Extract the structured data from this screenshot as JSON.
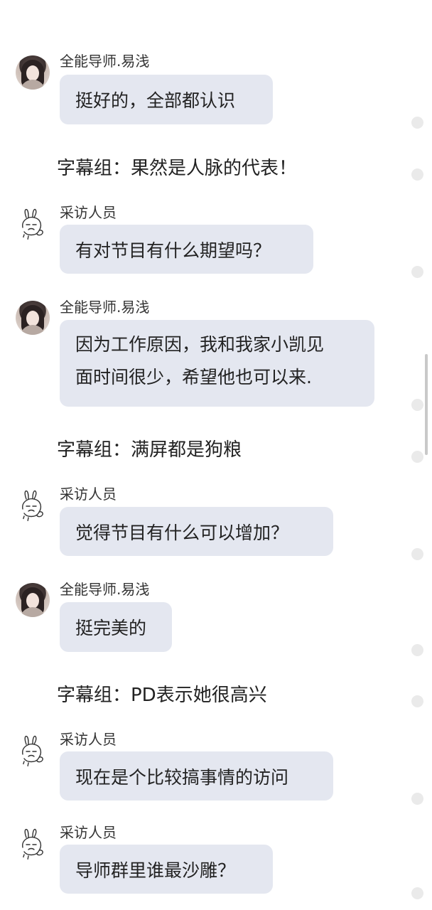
{
  "chat": {
    "speaker_a": "全能导师.易浅",
    "speaker_b": "采访人员",
    "messages": [
      {
        "text": "挺好的，全部都认识"
      },
      {
        "text": "有对节目有什么期望吗？"
      },
      {
        "lines": [
          "因为工作原因，我和我家小凯见",
          "面时间很少，希望他也可以来."
        ]
      },
      {
        "text": "觉得节目有什么可以增加？"
      },
      {
        "text": "挺完美的"
      },
      {
        "text": "现在是个比较搞事情的访问"
      },
      {
        "text": "导师群里谁最沙雕？"
      }
    ],
    "notes": [
      "字幕组：果然是人脉的代表！",
      "字幕组：满屏都是狗粮",
      "字幕组：PD表示她很高兴"
    ]
  },
  "icons": {
    "avatar_a": "girl-photo-avatar",
    "avatar_b": "bunny-sticker-avatar",
    "select_dot": "selection-circle-icon"
  },
  "colors": {
    "bubble": "#e4e7f0",
    "text": "#222222",
    "name": "#333333",
    "dot": "#eaeaea"
  }
}
